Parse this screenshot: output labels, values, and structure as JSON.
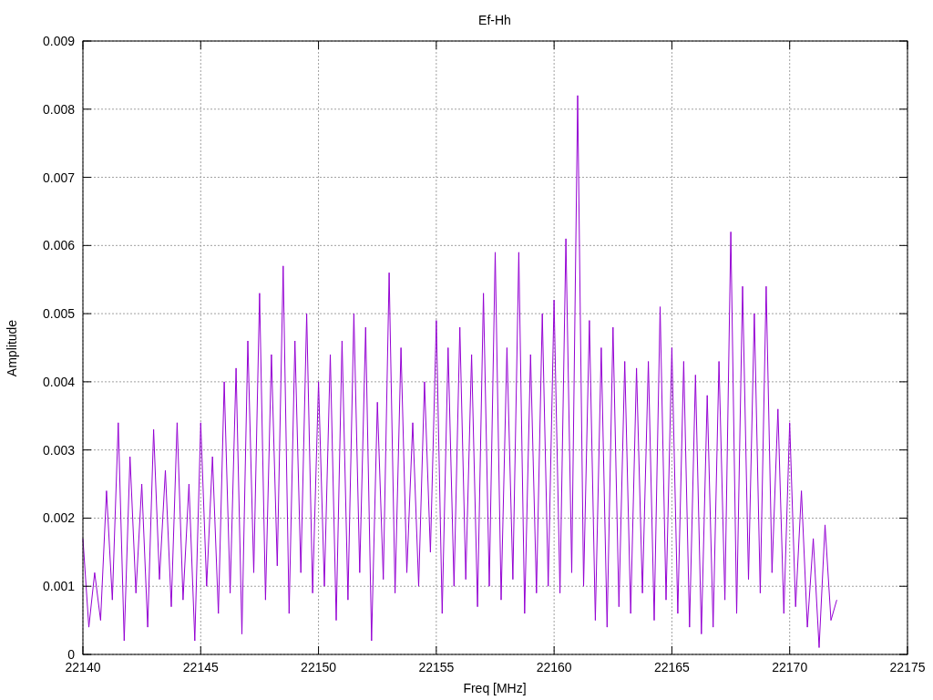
{
  "chart_data": {
    "type": "line",
    "grid": true,
    "title": "Ef-Hh",
    "xlabel": "Freq [MHz]",
    "ylabel": "Amplitude",
    "xlim": [
      22140,
      22175
    ],
    "ylim": [
      0,
      0.009
    ],
    "xticks": [
      22140,
      22145,
      22150,
      22155,
      22160,
      22165,
      22170,
      22175
    ],
    "yticks": [
      0,
      0.001,
      0.002,
      0.003,
      0.004,
      0.005,
      0.006,
      0.007,
      0.008,
      0.009
    ],
    "x": [
      22140,
      22140.25,
      22140.5,
      22140.75,
      22141,
      22141.25,
      22141.5,
      22141.75,
      22142,
      22142.25,
      22142.5,
      22142.75,
      22143,
      22143.25,
      22143.5,
      22143.75,
      22144,
      22144.25,
      22144.5,
      22144.75,
      22145,
      22145.25,
      22145.5,
      22145.75,
      22146,
      22146.25,
      22146.5,
      22146.75,
      22147,
      22147.25,
      22147.5,
      22147.75,
      22148,
      22148.25,
      22148.5,
      22148.75,
      22149,
      22149.25,
      22149.5,
      22149.75,
      22150,
      22150.25,
      22150.5,
      22150.75,
      22151,
      22151.25,
      22151.5,
      22151.75,
      22152,
      22152.25,
      22152.5,
      22152.75,
      22153,
      22153.25,
      22153.5,
      22153.75,
      22154,
      22154.25,
      22154.5,
      22154.75,
      22155,
      22155.25,
      22155.5,
      22155.75,
      22156,
      22156.25,
      22156.5,
      22156.75,
      22157,
      22157.25,
      22157.5,
      22157.75,
      22158,
      22158.25,
      22158.5,
      22158.75,
      22159,
      22159.25,
      22159.5,
      22159.75,
      22160,
      22160.25,
      22160.5,
      22160.75,
      22161,
      22161.25,
      22161.5,
      22161.75,
      22162,
      22162.25,
      22162.5,
      22162.75,
      22163,
      22163.25,
      22163.5,
      22163.75,
      22164,
      22164.25,
      22164.5,
      22164.75,
      22165,
      22165.25,
      22165.5,
      22165.75,
      22166,
      22166.25,
      22166.5,
      22166.75,
      22167,
      22167.25,
      22167.5,
      22167.75,
      22168,
      22168.25,
      22168.5,
      22168.75,
      22169,
      22169.25,
      22169.5,
      22169.75,
      22170,
      22170.25,
      22170.5,
      22170.75,
      22171,
      22171.25,
      22171.5,
      22171.75,
      22172
    ],
    "series": [
      {
        "color": "#9400d3",
        "values": [
          0.0017,
          0.0004,
          0.0012,
          0.0005,
          0.0024,
          0.0008,
          0.0034,
          0.0002,
          0.0029,
          0.0009,
          0.0025,
          0.0004,
          0.0033,
          0.0011,
          0.0027,
          0.0007,
          0.0034,
          0.0008,
          0.0025,
          0.0002,
          0.0034,
          0.001,
          0.0029,
          0.0006,
          0.004,
          0.0009,
          0.0042,
          0.0003,
          0.0046,
          0.0012,
          0.0053,
          0.0008,
          0.0044,
          0.0013,
          0.0057,
          0.0006,
          0.0046,
          0.0012,
          0.005,
          0.0009,
          0.004,
          0.001,
          0.0044,
          0.0005,
          0.0046,
          0.0008,
          0.005,
          0.0012,
          0.0048,
          0.0002,
          0.0037,
          0.0011,
          0.0056,
          0.0009,
          0.0045,
          0.0012,
          0.0034,
          0.001,
          0.004,
          0.0015,
          0.0049,
          0.0006,
          0.0045,
          0.001,
          0.0048,
          0.0011,
          0.0044,
          0.0007,
          0.0053,
          0.001,
          0.0059,
          0.0008,
          0.0045,
          0.0011,
          0.0059,
          0.0006,
          0.0044,
          0.0009,
          0.005,
          0.001,
          0.0052,
          0.0009,
          0.0061,
          0.0012,
          0.0082,
          0.001,
          0.0049,
          0.0005,
          0.0045,
          0.0004,
          0.0048,
          0.0007,
          0.0043,
          0.0006,
          0.0042,
          0.0009,
          0.0043,
          0.0005,
          0.0051,
          0.0008,
          0.0045,
          0.0006,
          0.0043,
          0.0004,
          0.0041,
          0.0003,
          0.0038,
          0.0004,
          0.0043,
          0.0008,
          0.0062,
          0.0006,
          0.0054,
          0.0011,
          0.005,
          0.0009,
          0.0054,
          0.0012,
          0.0036,
          0.0006,
          0.0034,
          0.0007,
          0.0024,
          0.0004,
          0.0017,
          0.0001,
          0.0019,
          0.0005,
          0.0008
        ]
      }
    ]
  }
}
